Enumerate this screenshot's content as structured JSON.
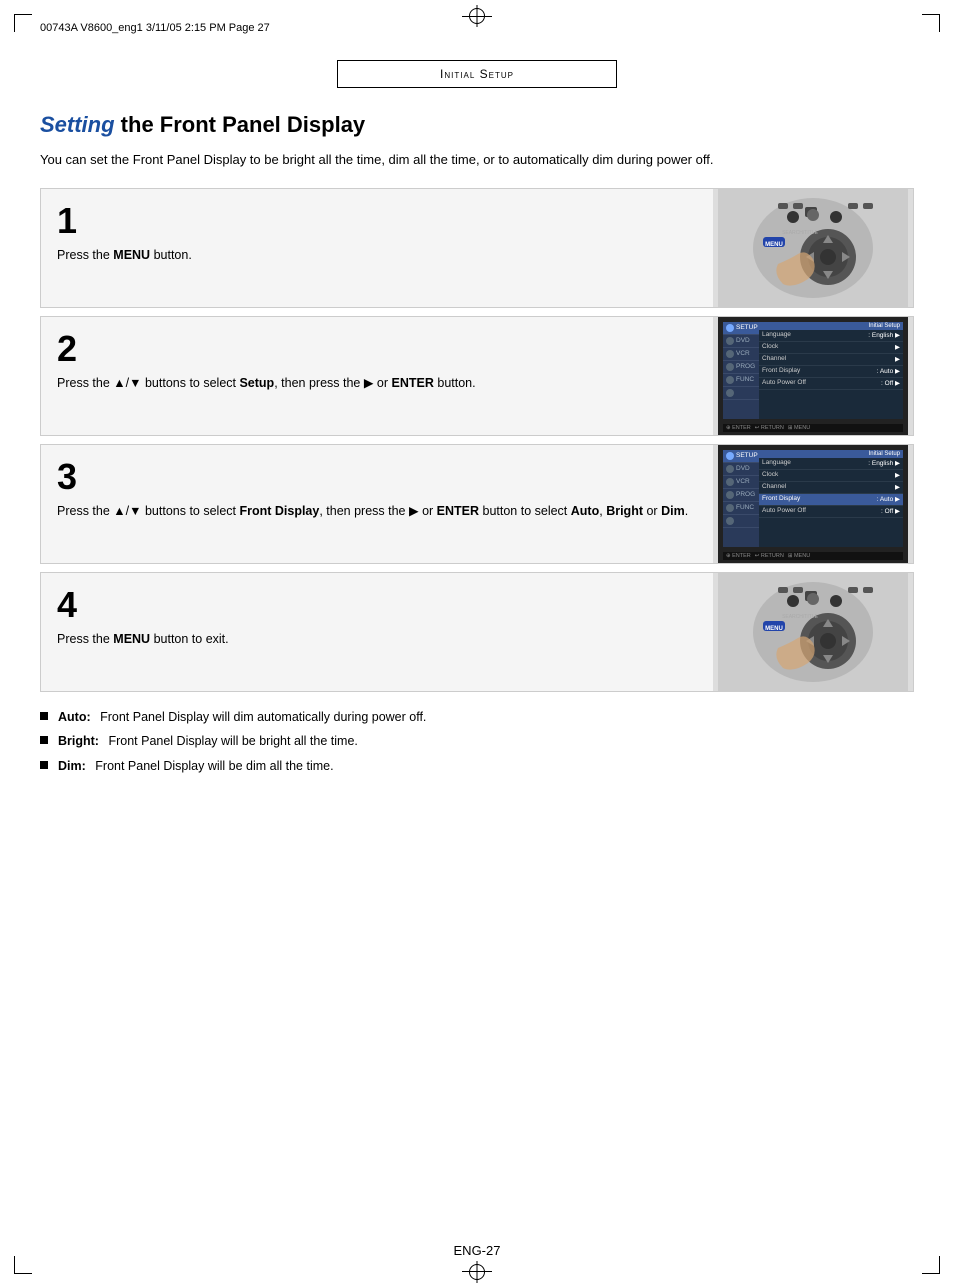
{
  "file_info": "00743A  V8600_eng1   3/11/05   2:15 PM    Page 27",
  "section_banner": "Initial Setup",
  "page_heading": {
    "highlight": "Setting",
    "rest": " the Front Panel Display"
  },
  "intro_text": "You can set the Front Panel Display to be bright all the time, dim all the time, or to automatically dim during power off.",
  "steps": [
    {
      "number": "1",
      "text_parts": [
        "Press the ",
        "MENU",
        " button."
      ],
      "type": "remote"
    },
    {
      "number": "2",
      "text_parts": [
        "Press the ▲/▼ buttons to select ",
        "Setup",
        ", then press the ▶ or ",
        "ENTER",
        " button."
      ],
      "type": "menu",
      "highlighted_row": "Language"
    },
    {
      "number": "3",
      "text_parts": [
        "Press the ▲/▼ buttons to select ",
        "Front Display",
        ", then press the ▶ or ",
        "ENTER",
        " button to select ",
        "Auto",
        ", ",
        "Bright",
        " or ",
        "Dim",
        "."
      ],
      "type": "menu",
      "highlighted_row": "Front Display"
    },
    {
      "number": "4",
      "text_parts": [
        "Press the ",
        "MENU",
        " button to exit."
      ],
      "type": "remote"
    }
  ],
  "menu_items": {
    "sidebar": [
      "SETUP",
      "DVD",
      "VCR",
      "PROG",
      "FUNC"
    ],
    "title": "Initial Setup",
    "rows": [
      {
        "label": "Language",
        "value": ": English",
        "arrow": "▶"
      },
      {
        "label": "Clock",
        "value": "",
        "arrow": "▶"
      },
      {
        "label": "Channel",
        "value": "",
        "arrow": "▶"
      },
      {
        "label": "Front Display",
        "value": ": Auto",
        "arrow": "▶"
      },
      {
        "label": "Auto Power Off",
        "value": ": Off",
        "arrow": "▶"
      }
    ],
    "footer": [
      "⊕ ENTER",
      "↩ RETURN",
      "⊞ MENU"
    ]
  },
  "bullets": [
    {
      "label": "Auto:",
      "text": "Front Panel Display will dim automatically during power off."
    },
    {
      "label": "Bright:",
      "text": "Front Panel Display will be bright all the time."
    },
    {
      "label": "Dim:",
      "text": "Front Panel Display will be dim all the time."
    }
  ],
  "page_number": "ENG-27"
}
